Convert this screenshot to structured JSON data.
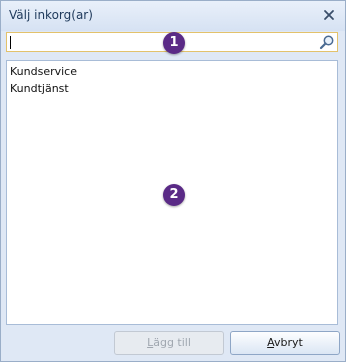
{
  "window": {
    "title": "Välj inkorg(ar)"
  },
  "search": {
    "value": "",
    "placeholder": ""
  },
  "list": {
    "items": [
      {
        "label": "Kundservice"
      },
      {
        "label": "Kundtjänst"
      }
    ]
  },
  "annotations": {
    "badge_1": "1",
    "badge_2": "2"
  },
  "buttons": {
    "add_mnemonic": "L",
    "add_rest": "ägg till",
    "add_enabled": false,
    "cancel_mnemonic": "A",
    "cancel_rest": "vbryt"
  },
  "icons": {
    "close": "close-icon",
    "search": "search-icon"
  },
  "colors": {
    "badge": "#5a2a86",
    "search_border": "#e3c26b",
    "dialog_background": "#dfe8f5"
  }
}
